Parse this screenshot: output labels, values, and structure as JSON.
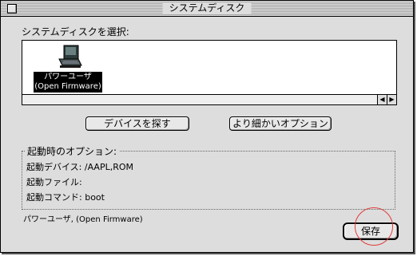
{
  "window": {
    "title": "システムディスク"
  },
  "select_label": "システムディスクを選択:",
  "disk": {
    "name_line1": "パワーユーザ",
    "name_line2": "(Open Firmware)"
  },
  "scroll": {
    "left_arrow": "◀",
    "right_arrow": "▶"
  },
  "buttons": {
    "find_device": "デバイスを探す",
    "more_options": "より細かいオプション"
  },
  "boot_options": {
    "title": "起動時のオプション:",
    "device_label": "起動デバイス:",
    "device_value": "/AAPL,ROM",
    "file_label": "起動ファイル:",
    "file_value": "",
    "command_label": "起動コマンド:",
    "command_value": "boot"
  },
  "status_text": "パワーユーザ, (Open Firmware)",
  "save_label": "保存",
  "colors": {
    "highlight_circle": "#e23b3b",
    "window_bg": "#dddddd"
  }
}
